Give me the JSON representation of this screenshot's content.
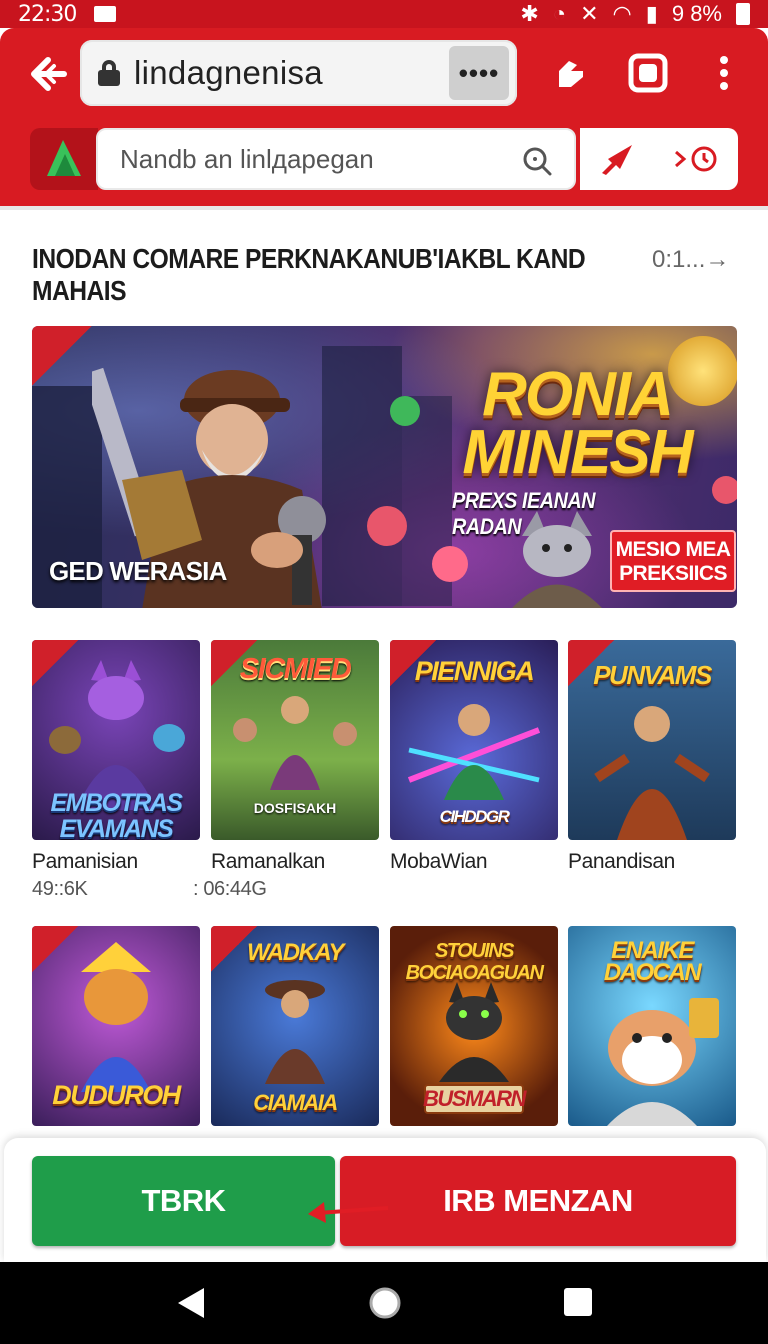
{
  "status_bar": {
    "time": "22:30",
    "battery": "9 8%"
  },
  "browser": {
    "url": "lindagnenisa",
    "search_placeholder": "Nandb an linlдapegan",
    "colors": {
      "toolbar": "#d81b22",
      "accent_green": "#1f9d4a"
    }
  },
  "section": {
    "title": "INODAN COMARE PERKNAKANUB'IAKBL KAND MAHAIS",
    "more_label": "0:1...→"
  },
  "banner": {
    "title_line1": "RONIA",
    "title_line2": "MINESH",
    "subtitle": "PREXS IEANAN RADAN",
    "badge_line1": "MESIO MEA",
    "badge_line2": "PREKSIICS",
    "caption": "GED WERASIA"
  },
  "games_row1": [
    {
      "art_title": "EMBOTRAS EVAMANS",
      "name": "Pamanisian",
      "stat": "49::6K"
    },
    {
      "art_title": "SICMIED",
      "art_sub": "DOSFISAKH",
      "name": "Ramanalkan",
      "stat": ": 06:44G"
    },
    {
      "art_title": "PIENNIGA",
      "art_sub": "CIHDDGR",
      "name": "MobaWian",
      "stat": ""
    },
    {
      "art_title": "PUNVAMS",
      "name": "Panandisan",
      "stat": ""
    }
  ],
  "games_row2": [
    {
      "art_title": "DUDUROH"
    },
    {
      "art_title": "WADKAY",
      "art_sub": "CIAMAIA"
    },
    {
      "art_title": "STOUINS BOCIAOAGUAN",
      "art_sub": "BUSMARN"
    },
    {
      "art_title": "ENAIKE DAOCAN"
    }
  ],
  "actions": {
    "primary": "TBRK",
    "secondary": "IRB MENZAN"
  }
}
